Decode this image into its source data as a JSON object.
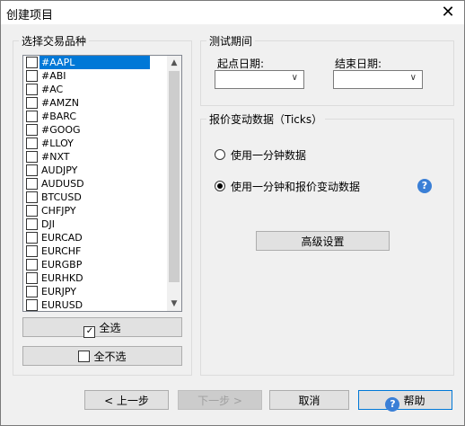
{
  "window": {
    "title": "创建项目"
  },
  "symbols_group": {
    "label": "选择交易品种",
    "items": [
      {
        "label": "#AAPL",
        "selected": true
      },
      {
        "label": "#ABI"
      },
      {
        "label": "#AC"
      },
      {
        "label": "#AMZN"
      },
      {
        "label": "#BARC"
      },
      {
        "label": "#GOOG"
      },
      {
        "label": "#LLOY"
      },
      {
        "label": "#NXT"
      },
      {
        "label": "AUDJPY"
      },
      {
        "label": "AUDUSD"
      },
      {
        "label": "BTCUSD"
      },
      {
        "label": "CHFJPY"
      },
      {
        "label": "DJI"
      },
      {
        "label": "EURCAD"
      },
      {
        "label": "EURCHF"
      },
      {
        "label": "EURGBP"
      },
      {
        "label": "EURHKD"
      },
      {
        "label": "EURJPY"
      },
      {
        "label": "EURUSD"
      }
    ],
    "select_all": "全选",
    "deselect_all": "全不选"
  },
  "test_period": {
    "label": "测试期间",
    "start_label": "起点日期:",
    "end_label": "结束日期:"
  },
  "ticks": {
    "label": "报价变动数据（Ticks）",
    "option1": "使用一分钟数据",
    "option2": "使用一分钟和报价变动数据",
    "selected_option": 2,
    "advanced": "高级设置"
  },
  "footer": {
    "prev": "< 上一步",
    "next": "下一步 >",
    "cancel": "取消",
    "help": "帮助"
  }
}
